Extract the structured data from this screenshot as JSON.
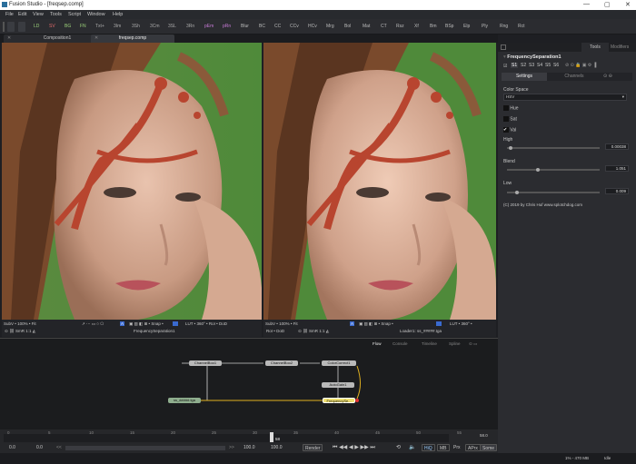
{
  "window": {
    "title": "Fusion Studio - [freqsep.comp]"
  },
  "menu": [
    "File",
    "Edit",
    "View",
    "Tools",
    "Script",
    "Window",
    "Help"
  ],
  "toolbar": [
    {
      "t": "LD",
      "c": "#9cd17a"
    },
    {
      "t": "SV",
      "c": "#e06a6a"
    },
    {
      "t": "BG",
      "c": "#9cd17a"
    },
    {
      "t": "FN",
      "c": "#9cd17a"
    },
    {
      "t": "Txt+",
      "c": "#aaaaaa"
    },
    {
      "t": "3Im",
      "c": "#aaaaaa"
    },
    {
      "t": "3Sh",
      "c": "#aaaaaa"
    },
    {
      "t": "3Cm",
      "c": "#aaaaaa"
    },
    {
      "t": "3SL",
      "c": "#aaaaaa"
    },
    {
      "t": "3Rn",
      "c": "#aaaaaa"
    },
    {
      "t": "pEm",
      "c": "#c77bd6"
    },
    {
      "t": "pRn",
      "c": "#c77bd6"
    },
    {
      "t": "Blur",
      "c": "#bbbbbb"
    },
    {
      "t": "BC",
      "c": "#bbbbbb"
    },
    {
      "t": "CC",
      "c": "#bbbbbb"
    },
    {
      "t": "CCv",
      "c": "#bbbbbb"
    },
    {
      "t": "HCv",
      "c": "#bbbbbb"
    },
    {
      "t": "Mrg",
      "c": "#bbbbbb"
    },
    {
      "t": "Bol",
      "c": "#bbbbbb"
    },
    {
      "t": "Mat",
      "c": "#bbbbbb"
    },
    {
      "t": "CT",
      "c": "#bbbbbb"
    },
    {
      "t": "Rsz",
      "c": "#bbbbbb"
    },
    {
      "t": "Xf",
      "c": "#bbbbbb"
    },
    {
      "t": "Bm",
      "c": "#bbbbbb"
    },
    {
      "t": "BSp",
      "c": "#bbbbbb"
    },
    {
      "t": "Elp",
      "c": "#bbbbbb"
    },
    {
      "t": "Ply",
      "c": "#bbbbbb"
    },
    {
      "t": "Rng",
      "c": "#bbbbbb"
    },
    {
      "t": "Rct",
      "c": "#bbbbbb"
    }
  ],
  "tabs": [
    {
      "label": "Composition1"
    },
    {
      "label": "freqsep.comp"
    }
  ],
  "viewer_left": {
    "bottom_bar": "SubV  •  100%  •  Fit",
    "lut": "LUT  •  360°  •  RoI  •  DoD",
    "footer_label": "FrequencySeparation1"
  },
  "viewer_right": {
    "bottom_bar": "SubV  •  100%  •  Fit",
    "lut": "LUT  •  360°  •",
    "roi": "RoI  •  DoD",
    "footer_label": "Loader1: ss_#####.tga"
  },
  "inspector": {
    "tabs": [
      "Tools",
      "Modifiers"
    ],
    "node_title": "FrequencySeparation1",
    "versions": [
      "S1",
      "S2",
      "S3",
      "S4",
      "S5",
      "S6"
    ],
    "subtabs": [
      "Settings",
      "Channels"
    ],
    "color_space_label": "Color Space",
    "color_space_value": "HSV",
    "channels": [
      {
        "label": "Hue",
        "checked": false
      },
      {
        "label": "Sat",
        "checked": false
      },
      {
        "label": "Val",
        "checked": true
      }
    ],
    "high_label": "High",
    "high_value": "0.00038",
    "high_level": 0.02,
    "blend_label": "Blend",
    "blend_value": "1.051",
    "blend_level": 0.33,
    "low_label": "Low",
    "low_value": "0.009",
    "low_level": 0.09,
    "copyright": "(C) 2019 by Chris Huf www.splotchdog.com"
  },
  "flow": {
    "tabs": [
      "Flow",
      "Console",
      "Timeline",
      "Spline"
    ],
    "nodes": [
      "ChannelBoo1",
      "ChannelBoo2",
      "ColorCorrect1",
      "AutoGain1",
      "ss_#####.tga",
      "FrequencySe..."
    ]
  },
  "timeline": {
    "ticks": [
      "0",
      "5",
      "10",
      "15",
      "20",
      "25",
      "30",
      "35",
      "40",
      "45",
      "50",
      "55"
    ],
    "current": "58",
    "end": "58.0"
  },
  "transport": {
    "start": "0.0",
    "start2": "0.0",
    "end": "100.0",
    "end2": "100.0",
    "render": "Render",
    "hiq": "HiQ",
    "mb": "MB",
    "prx": "Prx",
    "aprx": "APrx",
    "some": "Some"
  },
  "status": {
    "zoom": "1%",
    "mem": "470 MB",
    "state": "Idle"
  }
}
